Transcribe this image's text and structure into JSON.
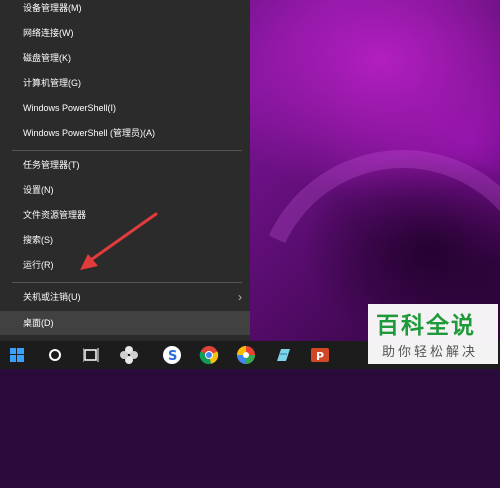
{
  "menu": {
    "items": [
      {
        "label": "设备管理器(M)"
      },
      {
        "label": "网络连接(W)"
      },
      {
        "label": "磁盘管理(K)"
      },
      {
        "label": "计算机管理(G)"
      },
      {
        "label": "Windows PowerShell(I)"
      },
      {
        "label": "Windows PowerShell (管理员)(A)"
      },
      {
        "label": "任务管理器(T)"
      },
      {
        "label": "设置(N)"
      },
      {
        "label": "文件资源管理器"
      },
      {
        "label": "搜索(S)"
      },
      {
        "label": "运行(R)"
      },
      {
        "label": "关机或注销(U)"
      },
      {
        "label": "桌面(D)"
      }
    ],
    "submenu_indicator": "›"
  },
  "taskbar": {
    "icons": [
      "windows-start-icon",
      "cortana-icon",
      "task-view-icon",
      "app-fan-icon",
      "sogou-icon",
      "chrome-icon",
      "color-wheel-icon",
      "notepad-icon",
      "powerpoint-icon"
    ]
  },
  "watermark": {
    "title": "百科全说",
    "subtitle": "助你轻松解决"
  },
  "colors": {
    "menu_bg": "#2b2b2b",
    "menu_highlight": "#414141",
    "annotation_arrow": "#e23b3b",
    "watermark_green": "#1f9a3a"
  }
}
